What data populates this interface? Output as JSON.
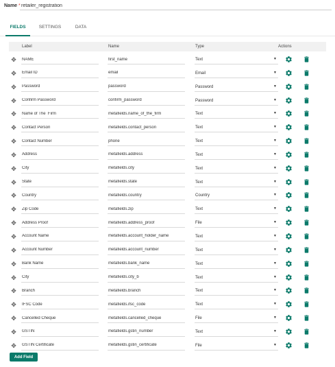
{
  "form": {
    "name_label": "Name",
    "required_mark": "*",
    "name_value": "retailer_registration"
  },
  "tabs": [
    {
      "label": "FIELDS",
      "active": true
    },
    {
      "label": "SETTINGS",
      "active": false
    },
    {
      "label": "DATA",
      "active": false
    }
  ],
  "table": {
    "headers": {
      "label": "Label",
      "name": "Name",
      "type": "Type",
      "actions": "Actions"
    },
    "rows": [
      {
        "label": "NAME",
        "name": "first_name",
        "type": "Text"
      },
      {
        "label": "Email ID",
        "name": "email",
        "type": "Email"
      },
      {
        "label": "Password",
        "name": "password",
        "type": "Password"
      },
      {
        "label": "Confirm Password",
        "name": "confirm_password",
        "type": "Password"
      },
      {
        "label": "Name of The  Firm",
        "name": "metafields.name_of_the_firm",
        "type": "Text"
      },
      {
        "label": "Contact Person",
        "name": "metafields.contact_person",
        "type": "Text"
      },
      {
        "label": "Contact Number",
        "name": "phone",
        "type": "Text"
      },
      {
        "label": "Address",
        "name": "metafields.address",
        "type": "Text"
      },
      {
        "label": "City",
        "name": "metafields.city",
        "type": "Text"
      },
      {
        "label": "State",
        "name": "metafields.state",
        "type": "Text"
      },
      {
        "label": "Country",
        "name": "metafields.country",
        "type": "Country"
      },
      {
        "label": "Zip Code",
        "name": "metafields.zip",
        "type": "Text"
      },
      {
        "label": "Address Proof",
        "name": "metafields.address_proof",
        "type": "File"
      },
      {
        "label": "Account Name",
        "name": "metafields.account_holder_name",
        "type": "Text"
      },
      {
        "label": "Account Number",
        "name": "metafields.account_number",
        "type": "Text"
      },
      {
        "label": "Bank Name",
        "name": "metafields.bank_name",
        "type": "Text"
      },
      {
        "label": "City",
        "name": "metafields.city_b",
        "type": "Text"
      },
      {
        "label": "Branch",
        "name": "metafields.branch",
        "type": "Text"
      },
      {
        "label": "IFSC Code",
        "name": "metafields.ifsc_code",
        "type": "Text"
      },
      {
        "label": "Cancelled Cheque",
        "name": "metafields.cancelled_cheque",
        "type": "File"
      },
      {
        "label": "GSTIN",
        "name": "metafields.gstin_number",
        "type": "Text"
      },
      {
        "label": "GSTIN Certificate",
        "name": "metafields.gstin_certificate",
        "type": "File"
      }
    ],
    "row_icons": {
      "drag": "drag-handle-icon",
      "edit": "gear-icon",
      "delete": "trash-icon"
    },
    "dropdown_icon": "caret-down-icon"
  },
  "add_field_label": "Add Field",
  "colors": {
    "accent": "#0b7a6a",
    "required": "#e53935",
    "header_bg": "#f1f1f1"
  }
}
